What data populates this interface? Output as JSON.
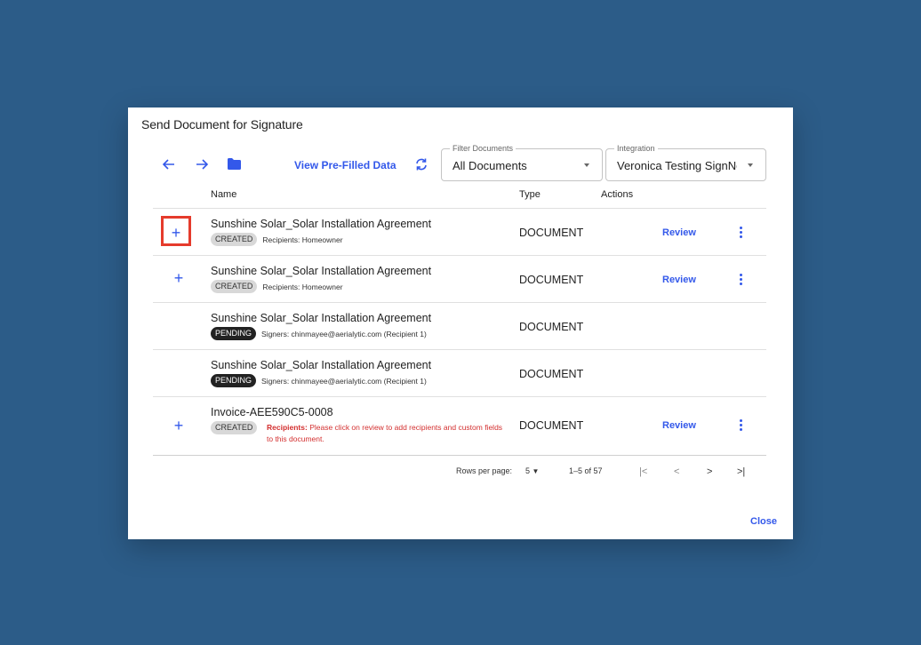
{
  "dialog": {
    "title": "Send Document for Signature",
    "close_label": "Close"
  },
  "toolbar": {
    "back_icon": "arrow-left-icon",
    "forward_icon": "arrow-right-icon",
    "folder_icon": "folder-icon",
    "view_prefilled_label": "View Pre-Filled Data",
    "refresh_icon": "refresh-icon"
  },
  "filter": {
    "legend": "Filter Documents",
    "value": "All Documents"
  },
  "integration": {
    "legend": "Integration",
    "value": "Veronica Testing SignNc"
  },
  "table": {
    "headers": {
      "name": "Name",
      "type": "Type",
      "actions": "Actions"
    },
    "rows": [
      {
        "name": "Sunshine Solar_Solar Installation Agreement",
        "status": "CREATED",
        "detail": "Recipients: Homeowner",
        "type": "DOCUMENT",
        "review": "Review"
      },
      {
        "name": "Sunshine Solar_Solar Installation Agreement",
        "status": "CREATED",
        "detail": "Recipients: Homeowner",
        "type": "DOCUMENT",
        "review": "Review"
      },
      {
        "name": "Sunshine Solar_Solar Installation Agreement",
        "status": "PENDING",
        "detail": "Signers: chinmayee@aerialytic.com (Recipient 1)",
        "type": "DOCUMENT"
      },
      {
        "name": "Sunshine Solar_Solar Installation Agreement",
        "status": "PENDING",
        "detail": "Signers: chinmayee@aerialytic.com (Recipient 1)",
        "type": "DOCUMENT"
      },
      {
        "name": "Invoice-AEE590C5-0008",
        "status": "CREATED",
        "error_label": "Recipients:",
        "error_text": " Please click on review to add recipients and custom fields to this document.",
        "type": "DOCUMENT",
        "review": "Review"
      }
    ]
  },
  "pagination": {
    "rows_per_page_label": "Rows per page:",
    "rows_per_page_value": "5",
    "range": "1–5 of 57"
  },
  "colors": {
    "accent": "#3358ea",
    "backdrop": "#2c5c88",
    "highlight": "#e53b2c",
    "error": "#d32f2f"
  }
}
